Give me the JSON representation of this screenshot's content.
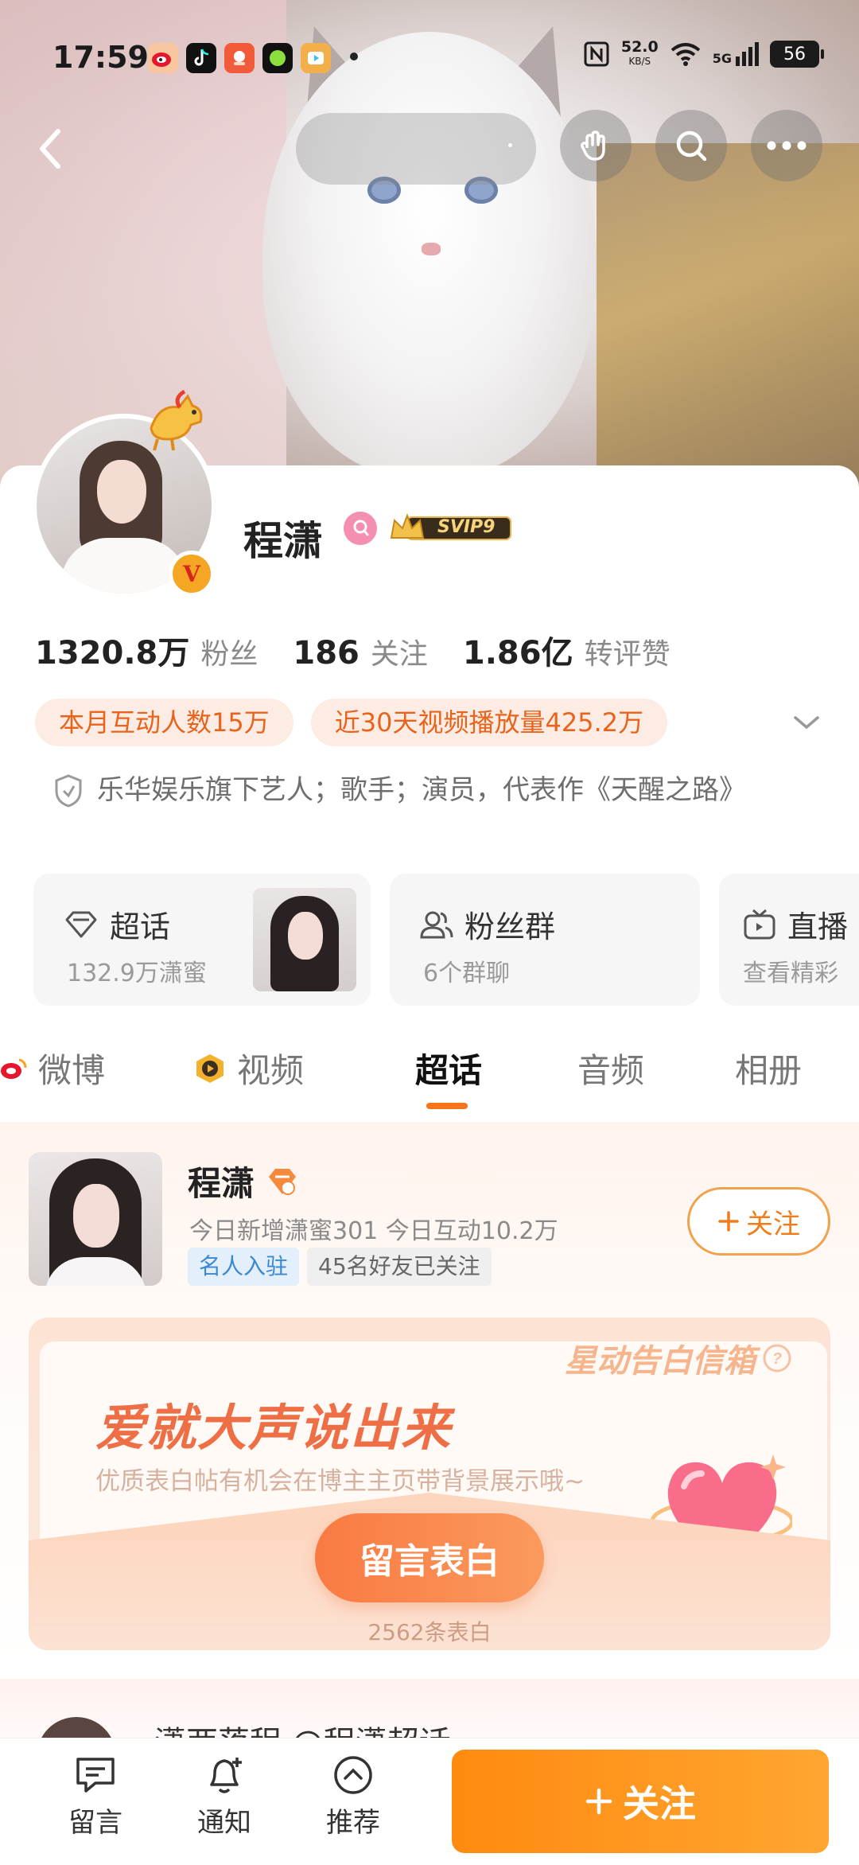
{
  "status_bar": {
    "time": "17:59",
    "network_speed": "52.0",
    "network_unit": "KB/S",
    "signal": "5G",
    "battery": "56"
  },
  "profile": {
    "name": "程潇",
    "svip_label": "SVIP9",
    "stats": [
      {
        "value": "1320.8万",
        "label": "粉丝"
      },
      {
        "value": "186",
        "label": "关注"
      },
      {
        "value": "1.86亿",
        "label": "转评赞"
      }
    ],
    "tags": [
      "本月互动人数15万",
      "近30天视频播放量425.2万"
    ],
    "intro": "乐华娱乐旗下艺人；歌手；演员，代表作《天醒之路》"
  },
  "features": [
    {
      "title": "超话",
      "sub": "132.9万潇蜜"
    },
    {
      "title": "粉丝群",
      "sub": "6个群聊"
    },
    {
      "title": "直播",
      "sub": "查看精彩"
    }
  ],
  "tabs": [
    {
      "label": "微博"
    },
    {
      "label": "视频"
    },
    {
      "label": "超话",
      "active": true
    },
    {
      "label": "音频"
    },
    {
      "label": "相册"
    }
  ],
  "topic": {
    "name": "程潇",
    "desc": "今日新增潇蜜301 今日互动10.2万",
    "tag_celebrity": "名人入驻",
    "tag_friends": "45名好友已关注",
    "follow_label": "关注"
  },
  "envelope": {
    "top_label": "星动告白信箱",
    "title": "爱就大声说出来",
    "subtitle": "优质表白帖有机会在博主主页带背景展示哦~",
    "button": "留言表白",
    "count": "2562条表白"
  },
  "peek": {
    "text": "潇两落程 @程潇超话"
  },
  "bottom_bar": {
    "message": "留言",
    "notify": "通知",
    "recommend": "推荐",
    "follow": "关注"
  },
  "colors": {
    "accent": "#f5751d",
    "follow_gradient_start": "#ff8a10",
    "follow_gradient_end": "#ffa631",
    "tag_bg": "#fdece4",
    "tag_text": "#e8631c"
  }
}
